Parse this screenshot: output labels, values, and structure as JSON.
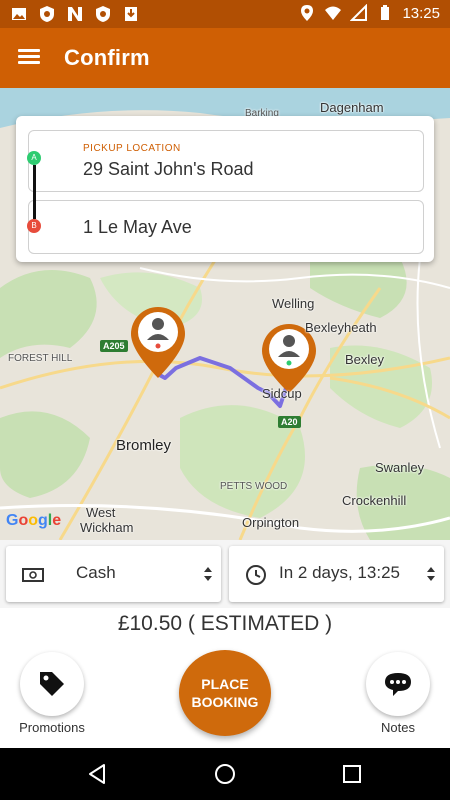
{
  "status_bar": {
    "time": "13:25",
    "left_icons": [
      "image-icon",
      "shield-icon",
      "n-icon",
      "shield-icon",
      "download-icon"
    ],
    "right_icons": [
      "location-icon",
      "wifi-icon",
      "signal-icon",
      "battery-icon"
    ]
  },
  "app_bar": {
    "title": "Confirm",
    "menu_icon": "hamburger-menu-icon",
    "color": "#cf5f04"
  },
  "locations": {
    "pickup_label": "PICKUP LOCATION",
    "pickup_value": "29 Saint John's Road",
    "dropoff_value": "1 Le May Ave",
    "marker_a": "A",
    "marker_b": "B"
  },
  "map": {
    "places": {
      "dagenham": "Dagenham",
      "barking": "Barking",
      "welling": "Welling",
      "bexleyheath": "Bexleyheath",
      "bexley": "Bexley",
      "forest_hill": "FOREST HILL",
      "sidcup": "Sidcup",
      "bromley": "Bromley",
      "swanley": "Swanley",
      "petts_wood": "PETTS WOOD",
      "crockenhill": "Crockenhill",
      "west": "West",
      "wickham": "Wickham",
      "orpington": "Orpington"
    },
    "roads": {
      "a205": "A205",
      "a20": "A20"
    },
    "attribution": [
      "G",
      "o",
      "o",
      "g",
      "l",
      "e"
    ],
    "route_color": "#7b6fe0",
    "pin_color": "#cf6a0c"
  },
  "selectors": {
    "payment": "Cash",
    "payment_icon": "cash-icon",
    "time": "In 2 days, 13:25",
    "time_icon": "clock-icon"
  },
  "price": "£10.50 ( ESTIMATED )",
  "actions": {
    "promotions_label": "Promotions",
    "place_booking_label": "PLACE BOOKING",
    "notes_label": "Notes"
  },
  "nav_bar": {
    "back_icon": "back-triangle-icon",
    "home_icon": "home-circle-icon",
    "recents_icon": "recents-square-icon"
  }
}
